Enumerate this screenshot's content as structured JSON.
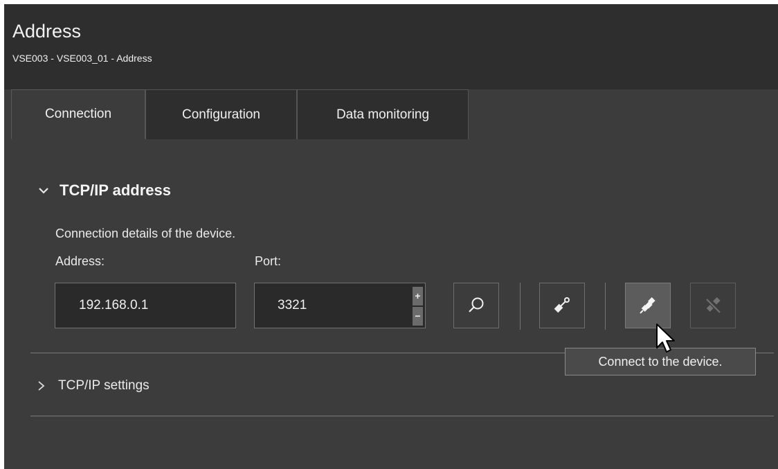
{
  "header": {
    "title": "Address",
    "breadcrumb": "VSE003 - VSE003_01 - Address"
  },
  "tabs": [
    {
      "label": "Connection",
      "active": true
    },
    {
      "label": "Configuration",
      "active": false
    },
    {
      "label": "Data monitoring",
      "active": false
    }
  ],
  "tcpip_section": {
    "title": "TCP/IP address",
    "description": "Connection details of the device.",
    "address_label": "Address:",
    "address_value": "192.168.0.1",
    "port_label": "Port:",
    "port_value": "3321",
    "port_increment": "+",
    "port_decrement": "−",
    "buttons": [
      {
        "icon": "search-icon"
      },
      {
        "icon": "plug-icon"
      },
      {
        "icon": "connect-icon"
      },
      {
        "icon": "disconnect-icon"
      }
    ]
  },
  "settings_section": {
    "title": "TCP/IP settings"
  },
  "tooltip": {
    "text": "Connect to the device."
  },
  "colors": {
    "header_bg": "#2e2e2e",
    "content_bg": "#3c3c3c",
    "field_bg": "#2a2a2a",
    "text": "#f0f0f0"
  }
}
